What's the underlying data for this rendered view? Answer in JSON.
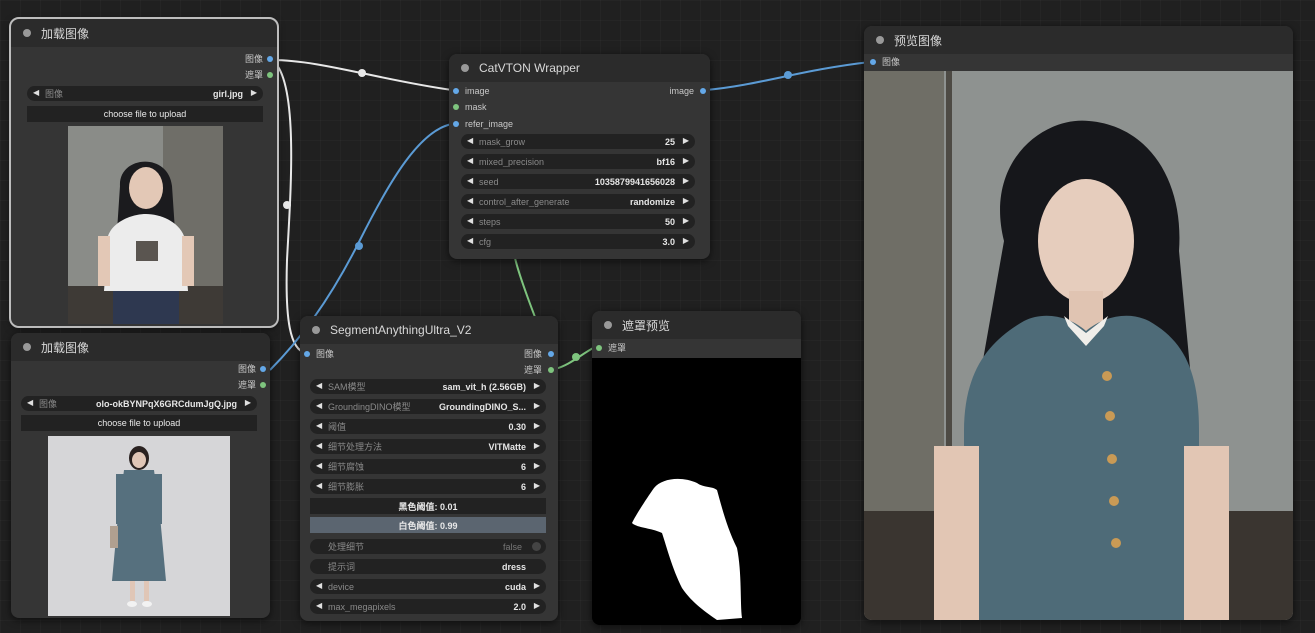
{
  "load_image_1": {
    "title": "加载图像",
    "out_image": "图像",
    "out_mask": "遮罩",
    "image_label": "图像",
    "image_value": "girl.jpg",
    "upload_label": "choose file to upload"
  },
  "load_image_2": {
    "title": "加载图像",
    "out_image": "图像",
    "out_mask": "遮罩",
    "image_label": "图像",
    "image_value": "olo-okBYNPqX6GRCdumJgQ.jpg",
    "upload_label": "choose file to upload"
  },
  "catvton": {
    "title": "CatVTON Wrapper",
    "in_image": "image",
    "in_mask": "mask",
    "in_refer": "refer_image",
    "out_image": "image",
    "widgets": [
      {
        "label": "mask_grow",
        "value": "25"
      },
      {
        "label": "mixed_precision",
        "value": "bf16"
      },
      {
        "label": "seed",
        "value": "1035879941656028"
      },
      {
        "label": "control_after_generate",
        "value": "randomize"
      },
      {
        "label": "steps",
        "value": "50"
      },
      {
        "label": "cfg",
        "value": "3.0"
      }
    ]
  },
  "segment": {
    "title": "SegmentAnythingUltra_V2",
    "in_image": "图像",
    "out_image": "图像",
    "out_mask": "遮罩",
    "widgets": [
      {
        "label": "SAM模型",
        "value": "sam_vit_h (2.56GB)"
      },
      {
        "label": "GroundingDINO模型",
        "value": "GroundingDINO_S..."
      },
      {
        "label": "阈值",
        "value": "0.30"
      },
      {
        "label": "细节处理方法",
        "value": "VITMatte"
      },
      {
        "label": "细节腐蚀",
        "value": "6"
      },
      {
        "label": "细节膨胀",
        "value": "6"
      }
    ],
    "black_threshold": "黑色阈值: 0.01",
    "white_threshold": "白色阈值: 0.99",
    "toggle_label": "处理细节",
    "toggle_value": "false",
    "prompt_label": "提示词",
    "prompt_value": "dress",
    "device_label": "device",
    "device_value": "cuda",
    "maxmp_label": "max_megapixels",
    "maxmp_value": "2.0"
  },
  "mask_preview": {
    "title": "遮罩预览",
    "in_mask": "遮罩"
  },
  "preview_image": {
    "title": "预览图像",
    "in_image": "图像"
  }
}
